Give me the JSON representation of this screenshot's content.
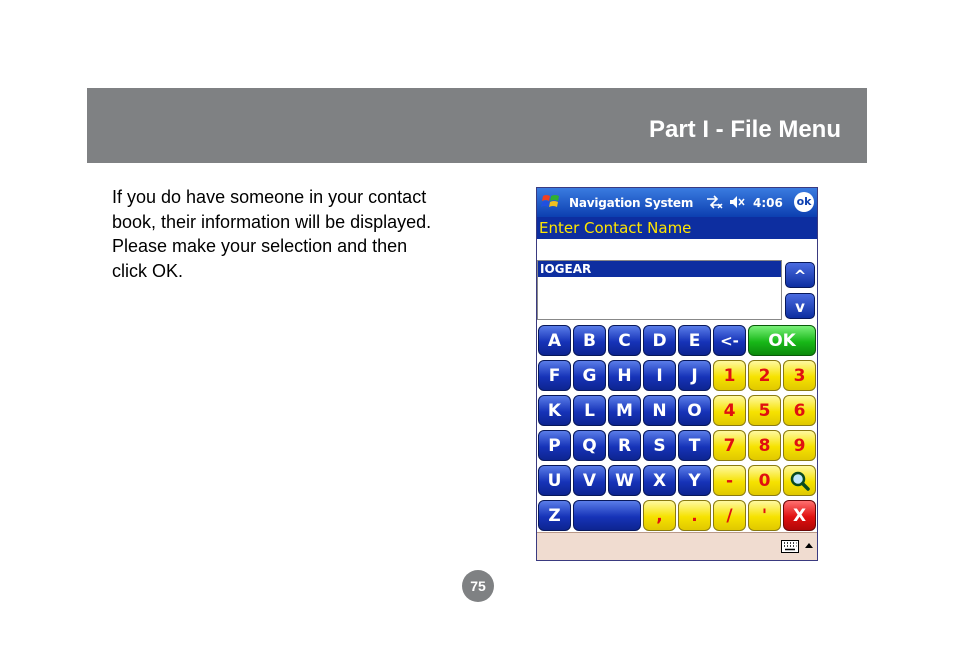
{
  "header": {
    "title": "Part I - File Menu"
  },
  "body": {
    "lines": [
      "If you do have someone in your contact",
      "book, their information will be displayed.",
      "Please make your selection and then",
      "click OK."
    ]
  },
  "page_number": "75",
  "device": {
    "app_title": "Navigation System",
    "clock": "4:06",
    "ok_label": "ok",
    "prompt": "Enter Contact Name",
    "input_value": "",
    "results": [
      "IOGEAR"
    ],
    "scroll_up": "^",
    "scroll_down": "v",
    "keys": {
      "A": "A",
      "B": "B",
      "C": "C",
      "D": "D",
      "E": "E",
      "backspace": "<-",
      "ok": "OK",
      "F": "F",
      "G": "G",
      "H": "H",
      "I": "I",
      "J": "J",
      "K": "K",
      "L": "L",
      "M": "M",
      "N": "N",
      "O": "O",
      "P": "P",
      "Q": "Q",
      "R": "R",
      "S": "S",
      "T": "T",
      "U": "U",
      "V": "V",
      "W": "W",
      "X": "X",
      "Y": "Y",
      "Z": "Z",
      "space": "",
      "d1": "1",
      "d2": "2",
      "d3": "3",
      "d4": "4",
      "d5": "5",
      "d6": "6",
      "d7": "7",
      "d8": "8",
      "d9": "9",
      "d0": "0",
      "dash": "-",
      "comma": ",",
      "period": ".",
      "slash": "/",
      "apostrophe": "'",
      "close": "X"
    },
    "icons": {
      "start": "windows-flag-icon",
      "connectivity": "connectivity-icon",
      "volume": "volume-mute-icon",
      "search": "magnifier-icon",
      "keyboard": "keyboard-icon"
    }
  }
}
